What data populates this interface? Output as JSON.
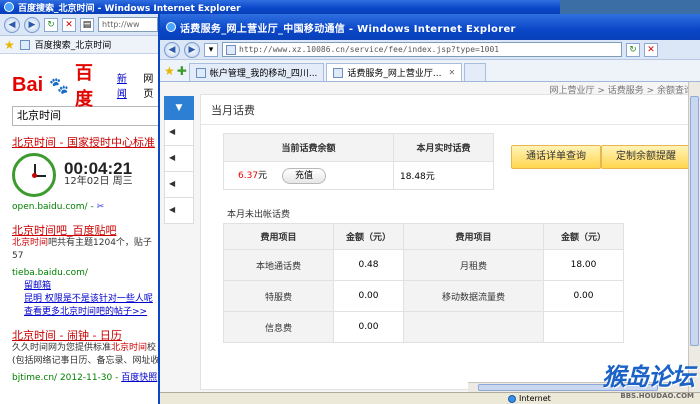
{
  "back_window": {
    "title": "百度搜索_北京时间 - Windows Internet Explorer",
    "address": "http://ww",
    "tab": "百度搜索_北京时间",
    "logo": {
      "bai": "Bai",
      "du": "百度"
    },
    "top_links": [
      "新闻",
      "网页"
    ],
    "search_value": "北京时间",
    "results": [
      {
        "title": "北京时间 - 国家授时中心标准"
      },
      {
        "title": "北京时间吧_百度贴吧",
        "desc_prefix": "北京时间",
        "desc_rest": "吧共有主题1204个，贴子57",
        "url": "tieba.baidu.com/",
        "subs": [
          "留邮箱",
          "昆明 权限是不是该针对一些人呢",
          "查看更多北京时间吧的帖子>>"
        ]
      },
      {
        "title": "北京时间 - 闹钟 - 日历",
        "desc1_prefix": "久久时间网为您提供标准",
        "desc1_hl": "北京时间",
        "desc1_suffix": "校",
        "desc2": "(包括网络记事日历、备忘录、网址收",
        "url": "bjtime.cn/ 2012-11-30 - ",
        "snapshot": "百度快照"
      }
    ],
    "clock": {
      "time": "00:04:21",
      "date": "12年02日 周三",
      "url": "open.baidu.com/ - "
    }
  },
  "front_window": {
    "title": "话费服务_网上营业厅_中国移动通信 - Windows Internet Explorer",
    "address_prefix": "http://www.",
    "address_rest": "xz.10086.cn/service/fee/index.jsp?type=1001",
    "tabs": [
      {
        "label": "帐户管理_我的移动_四川..."
      },
      {
        "label": "话费服务_网上营业厅..."
      }
    ],
    "top_right_text": "网上营业厅 > 话费服务 > 余额查询",
    "side_menu": [
      "▼",
      "◀",
      "◀",
      "◀",
      "◀"
    ],
    "panel_title": "当月话费",
    "balance_table": {
      "headers": [
        "当前话费余额",
        "本月实时话费"
      ],
      "amount": "6.37",
      "unit": "元",
      "recharge": "充值",
      "realtime": "18.48元"
    },
    "buttons": {
      "detail_query": "通话详单查询",
      "balance_alert": "定制余额提醒"
    },
    "unbilled_label": "本月未出帐话费",
    "fee_table": {
      "headers": [
        "费用项目",
        "金额（元）",
        "费用项目",
        "金额（元）"
      ],
      "rows": [
        [
          "本地通话费",
          "0.48",
          "月租费",
          "18.00"
        ],
        [
          "特服费",
          "0.00",
          "移动数据流量费",
          "0.00"
        ],
        [
          "信息费",
          "0.00",
          "",
          ""
        ]
      ]
    },
    "status_zone": "Internet"
  },
  "watermark": {
    "main": "猴岛论坛",
    "url": "BBS.HOUDAO.COM"
  },
  "colors": {
    "xp_title": "#0a46c8",
    "accent_red": "#e10601",
    "orange_button": "#ffd64e",
    "side_blue": "#2d7fd3"
  }
}
